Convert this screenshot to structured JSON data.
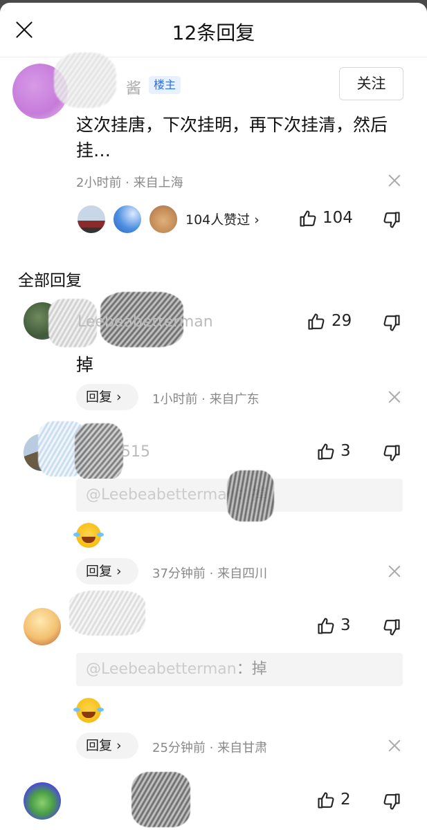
{
  "header": {
    "title": "12条回复",
    "close_icon": "close-icon"
  },
  "op": {
    "name_fragment": "酱",
    "tag": "楼主",
    "follow_label": "关注",
    "text": "这次挂唐，下次挂明，再下次挂清，然后挂…",
    "meta": "2小时前 · 来自上海",
    "likes_text": "104人赞过 ›",
    "like_count": "104"
  },
  "section_title": "全部回复",
  "replies": [
    {
      "name": "Leebeabetterman",
      "like_count": "29",
      "text": "掉",
      "reply_label": "回复 ›",
      "meta": "1小时前 · 来自广东"
    },
    {
      "name": "515",
      "like_count": "3",
      "quote_name": "@Leebeabetterman",
      "quote_text": "：掉",
      "reply_label": "回复 ›",
      "meta": "37分钟前 · 来自四川"
    },
    {
      "name": "",
      "like_count": "3",
      "quote_name": "@Leebeabetterman",
      "quote_text": "：掉",
      "reply_label": "回复 ›",
      "meta": "25分钟前 · 来自甘肃"
    },
    {
      "name": "",
      "like_count": "2"
    }
  ],
  "colors": {
    "tag_blue": "#2a6ef0",
    "meta_gray": "#888888",
    "backdrop": "#4a4a4a"
  }
}
